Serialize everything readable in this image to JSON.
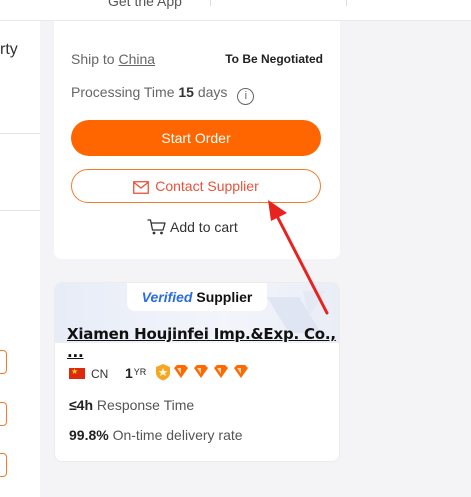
{
  "topbar": {
    "app_text": "Get the App"
  },
  "left_column": {
    "fragment_text": "rty"
  },
  "order": {
    "ship_to_label": "Ship to",
    "ship_to_country": "China",
    "shipping_cost": "To Be Negotiated",
    "processing_label": "Processing Time",
    "processing_days": "15",
    "processing_unit": "days",
    "info_glyph": "i",
    "start_order_label": "Start Order",
    "contact_supplier_label": "Contact Supplier",
    "add_to_cart_label": "Add to cart",
    "icons": [
      "info-icon",
      "mail-icon",
      "cart-icon"
    ]
  },
  "supplier": {
    "verified_word": "erified",
    "verified_v": "V",
    "supplier_word": "Supplier",
    "company_name": "Xiamen Houjinfei Imp.&Exp. Co., ...",
    "country_code": "CN",
    "years": "1",
    "years_unit": "YR",
    "response_value": "≤4h",
    "response_label": "Response Time",
    "ontime_value": "99.8%",
    "ontime_label": "On-time delivery rate",
    "diamond_count": 4
  },
  "colors": {
    "primary_orange": "#ff6600",
    "contact_text": "#e8523a",
    "verified_blue": "#2b6de0",
    "arrow_red": "#e8231f"
  }
}
